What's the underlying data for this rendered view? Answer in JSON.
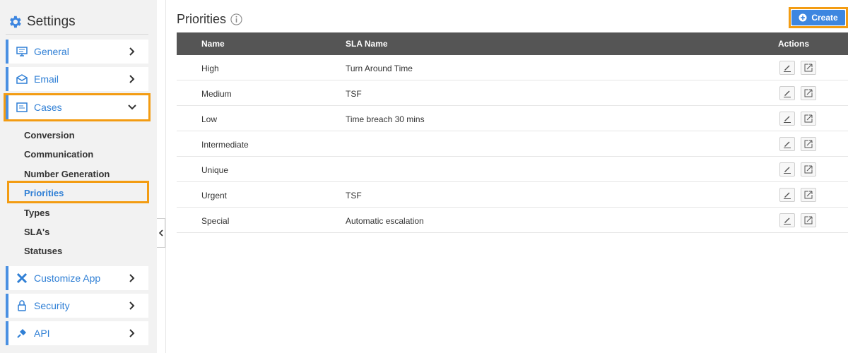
{
  "sidebar": {
    "title": "Settings",
    "menu": [
      {
        "label": "General",
        "icon": "monitor-icon"
      },
      {
        "label": "Email",
        "icon": "envelope-icon"
      },
      {
        "label": "Cases",
        "icon": "cases-icon"
      },
      {
        "label": "Customize App",
        "icon": "tools-icon"
      },
      {
        "label": "Security",
        "icon": "lock-icon"
      },
      {
        "label": "API",
        "icon": "plug-icon"
      }
    ],
    "cases_sub": [
      "Conversion",
      "Communication",
      "Number Generation",
      "Priorities",
      "Types",
      "SLA's",
      "Statuses"
    ],
    "active_sub": "Priorities"
  },
  "main": {
    "title": "Priorities",
    "create_label": "Create",
    "columns": {
      "name": "Name",
      "sla": "SLA Name",
      "actions": "Actions"
    },
    "rows": [
      {
        "name": "High",
        "sla": "Turn Around Time"
      },
      {
        "name": "Medium",
        "sla": "TSF"
      },
      {
        "name": "Low",
        "sla": "Time breach 30 mins"
      },
      {
        "name": "Intermediate",
        "sla": ""
      },
      {
        "name": "Unique",
        "sla": ""
      },
      {
        "name": "Urgent",
        "sla": "TSF"
      },
      {
        "name": "Special",
        "sla": "Automatic escalation"
      }
    ]
  },
  "colors": {
    "accent": "#2f7fd5",
    "highlight": "#f39c12",
    "header": "#555555",
    "button": "#3d86e0"
  }
}
